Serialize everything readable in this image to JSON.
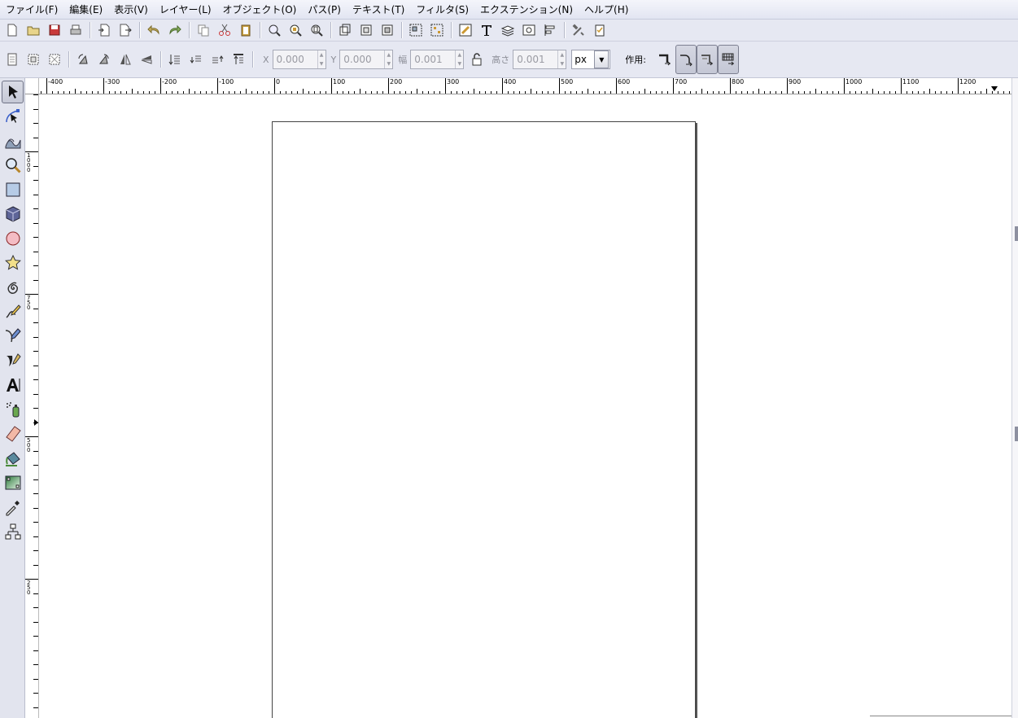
{
  "menubar": {
    "items": [
      "ファイル(F)",
      "編集(E)",
      "表示(V)",
      "レイヤー(L)",
      "オブジェクト(O)",
      "パス(P)",
      "テキスト(T)",
      "フィルタ(S)",
      "エクステンション(N)",
      "ヘルプ(H)"
    ]
  },
  "commands_bar": {
    "groups": [
      [
        "new-icon",
        "open-icon",
        "save-icon",
        "print-icon"
      ],
      [
        "import-icon",
        "export-icon"
      ],
      [
        "undo-icon",
        "redo-icon"
      ],
      [
        "copy-icon",
        "cut-icon",
        "paste-icon"
      ],
      [
        "zoom-selection-icon",
        "zoom-drawing-icon",
        "zoom-page-icon"
      ],
      [
        "duplicate-icon",
        "clone-icon",
        "unlink-clone-icon"
      ],
      [
        "group-icon",
        "ungroup-icon"
      ],
      [
        "xml-editor-icon",
        "text-font-icon",
        "layers-icon",
        "document-properties-icon",
        "align-distribute-icon"
      ],
      [
        "preferences-icon",
        "document-metadata-icon"
      ]
    ]
  },
  "controls_bar": {
    "select_buttons": [
      "select-all-icon",
      "select-all-layers-icon",
      "deselect-icon"
    ],
    "transform_buttons": [
      "rotate-ccw-icon",
      "rotate-cw-icon",
      "flip-horizontal-icon",
      "flip-vertical-icon"
    ],
    "zorder_buttons": [
      "lower-to-bottom-icon",
      "lower-icon",
      "raise-icon",
      "raise-to-top-icon"
    ],
    "x": {
      "label": "X",
      "value": "0.000"
    },
    "y": {
      "label": "Y",
      "value": "0.000"
    },
    "width": {
      "label": "幅",
      "value": "0.001"
    },
    "height": {
      "label": "高さ",
      "value": "0.001"
    },
    "unit": "px",
    "affect_label": "作用:",
    "affect_toggles": [
      {
        "name": "scale-stroke-toggle",
        "active": false
      },
      {
        "name": "scale-corners-toggle",
        "active": true
      },
      {
        "name": "move-gradients-toggle",
        "active": true
      },
      {
        "name": "move-patterns-toggle",
        "active": true
      }
    ]
  },
  "toolbox": {
    "tools": [
      {
        "name": "selector-tool",
        "icon": "arrow-icon",
        "active": true
      },
      {
        "name": "node-tool",
        "icon": "node-icon",
        "active": false
      },
      {
        "name": "tweak-tool",
        "icon": "tweak-icon",
        "active": false
      },
      {
        "name": "zoom-tool",
        "icon": "magnifier-icon",
        "active": false
      },
      {
        "name": "rect-tool",
        "icon": "rectangle-icon",
        "active": false
      },
      {
        "name": "3dbox-tool",
        "icon": "3dbox-icon",
        "active": false
      },
      {
        "name": "ellipse-tool",
        "icon": "circle-icon",
        "active": false
      },
      {
        "name": "star-tool",
        "icon": "star-icon",
        "active": false
      },
      {
        "name": "spiral-tool",
        "icon": "spiral-icon",
        "active": false
      },
      {
        "name": "pencil-tool",
        "icon": "pencil-icon",
        "active": false
      },
      {
        "name": "pen-tool",
        "icon": "pen-icon",
        "active": false
      },
      {
        "name": "calligraphy-tool",
        "icon": "calligraphy-icon",
        "active": false
      },
      {
        "name": "text-tool",
        "icon": "text-icon",
        "active": false
      },
      {
        "name": "spray-tool",
        "icon": "spray-icon",
        "active": false
      },
      {
        "name": "eraser-tool",
        "icon": "eraser-icon",
        "active": false
      },
      {
        "name": "paint-bucket-tool",
        "icon": "bucket-icon",
        "active": false
      },
      {
        "name": "gradient-tool",
        "icon": "gradient-icon",
        "active": false
      },
      {
        "name": "dropper-tool",
        "icon": "dropper-icon",
        "active": false
      },
      {
        "name": "connector-tool",
        "icon": "connector-icon",
        "active": false
      }
    ]
  },
  "rulers": {
    "horizontal_labels": [
      "-400",
      "-300",
      "-200",
      "-100",
      "0",
      "100",
      "200",
      "300",
      "400",
      "500",
      "600",
      "700",
      "800",
      "900",
      "1000",
      "1100",
      "1200"
    ],
    "vertical_labels": [
      "1000",
      "750",
      "500",
      "250"
    ]
  },
  "colors": {
    "ui_background": "#e6e8f2",
    "canvas": "#ffffff",
    "page_border": "#444444"
  }
}
